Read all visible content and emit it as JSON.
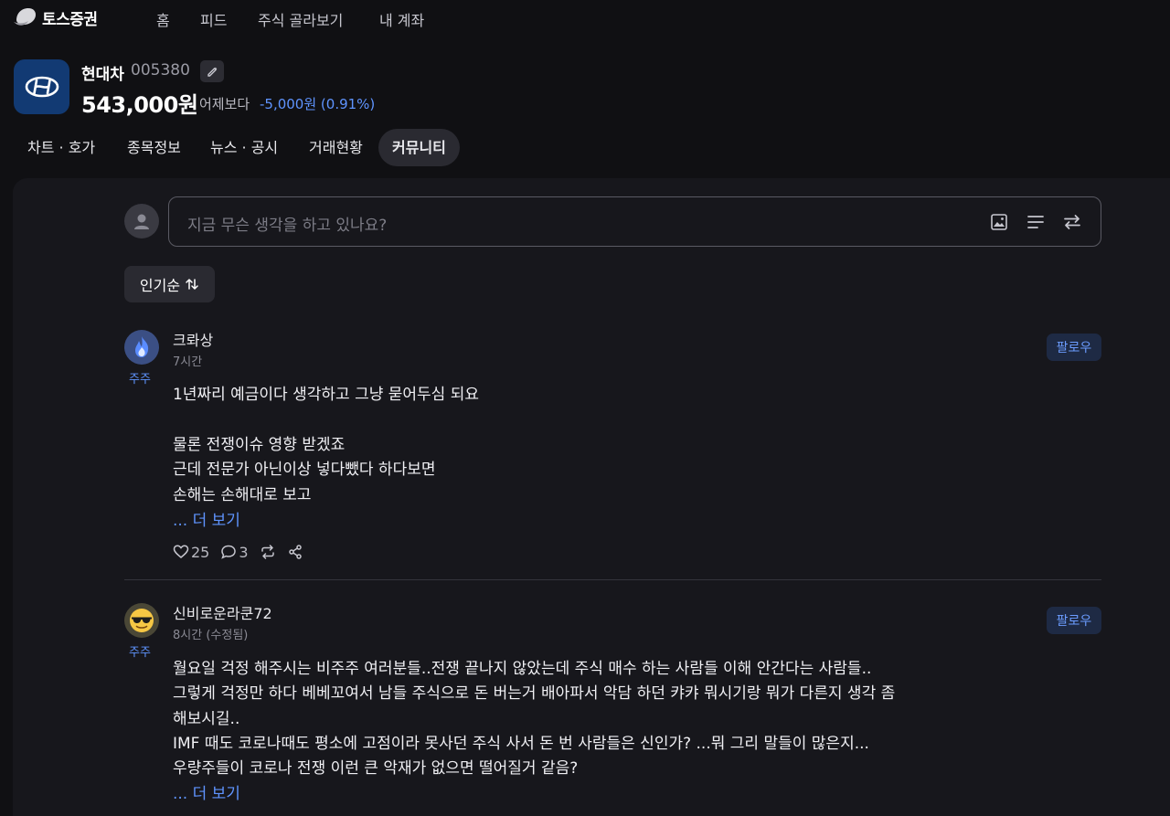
{
  "brand": {
    "name": "토스증권"
  },
  "nav": {
    "items": [
      "홈",
      "피드",
      "주식 골라보기",
      "내 계좌"
    ]
  },
  "stock": {
    "name": "현대차",
    "code": "005380",
    "price": "543,000원",
    "vs_label": "어제보다",
    "change": "-5,000원 (0.91%)",
    "logo_icon": "hyundai-logo",
    "change_color": "#5f94ff"
  },
  "tabs": [
    {
      "label": "차트 · 호가",
      "active": false
    },
    {
      "label": "종목정보",
      "active": false
    },
    {
      "label": "뉴스 · 공시",
      "active": false
    },
    {
      "label": "거래현황",
      "active": false
    },
    {
      "label": "커뮤니티",
      "active": true
    }
  ],
  "compose": {
    "placeholder": "지금 무슨 생각을 하고 있나요?",
    "icons": [
      "image-icon",
      "list-icon",
      "swap-icon"
    ]
  },
  "sort": {
    "label": "인기순",
    "icon": "sort-arrows-icon"
  },
  "posts": [
    {
      "author": "크롸상",
      "badge": "주주",
      "time": "7시간",
      "follow": "팔로우",
      "avatar_icon": "fire-avatar",
      "lines": [
        "1년짜리 예금이다 생각하고 그냥 묻어두심 되요",
        "",
        "물론 전쟁이슈 영향 받겠죠",
        "근데 전문가 아닌이상 넣다뺐다 하다보면",
        "손해는 손해대로 보고"
      ],
      "more": "... 더 보기",
      "likes": "25",
      "comments": "3"
    },
    {
      "author": "신비로운라쿤72",
      "badge": "주주",
      "time": "8시간 (수정됨)",
      "follow": "팔로우",
      "avatar_icon": "sunglasses-emoji-avatar",
      "lines": [
        "월요일 걱정 해주시는 비주주 여러분들..전쟁 끝나지 않았는데 주식 매수 하는 사람들 이해 안간다는 사람들..",
        "그렇게 걱정만 하다 베베꼬여서 남들 주식으로 돈 버는거 배아파서 악담 하던 캬캬 뭐시기랑 뭐가 다른지 생각 좀",
        "해보시길..",
        "IMF 때도 코로나때도 평소에 고점이라 못사던 주식 사서 돈 번 사람들은 신인가? ...뭐 그리 말들이 많은지...",
        "우량주들이 코로나 전쟁 이런 큰 악재가 없으면 떨어질거 같음?"
      ],
      "more": "... 더 보기"
    }
  ]
}
